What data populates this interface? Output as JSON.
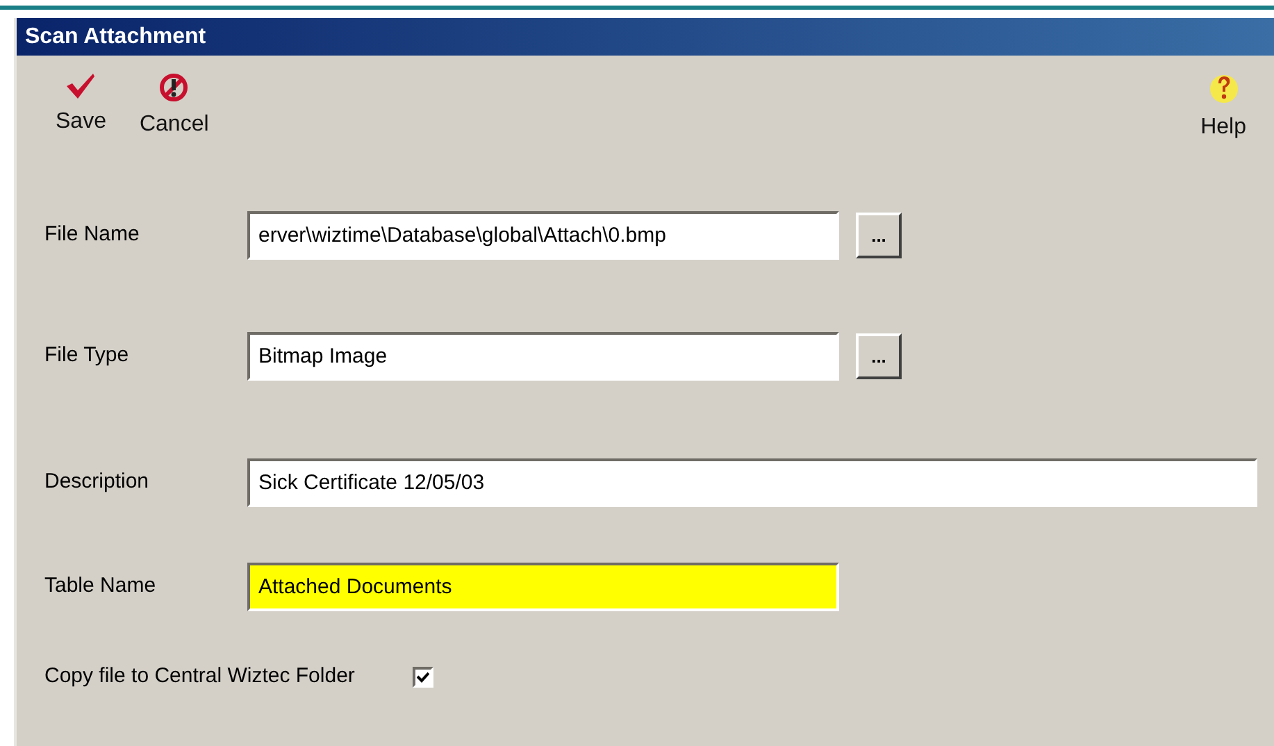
{
  "window": {
    "title": "Scan Attachment"
  },
  "toolbar": [
    {
      "kind": "save",
      "label": "Save"
    },
    {
      "kind": "cancel",
      "label": "Cancel"
    },
    {
      "kind": "help",
      "label": "Help"
    }
  ],
  "fields": [
    {
      "label": "File Name",
      "value": "erver\\wiztime\\Database\\global\\Attach\\0.bmp",
      "kind": "browse",
      "highlighted": false,
      "browse": "..."
    },
    {
      "label": "File Type",
      "value": "Bitmap Image",
      "kind": "browse",
      "highlighted": false,
      "browse": "..."
    },
    {
      "label": "Description",
      "value": "Sick Certificate 12/05/03",
      "kind": "long",
      "highlighted": false
    },
    {
      "label": "Table Name",
      "value": "Attached Documents",
      "kind": "short",
      "highlighted": true
    }
  ],
  "copy_option": {
    "label": "Copy file to Central Wiztec Folder",
    "checked": true
  }
}
